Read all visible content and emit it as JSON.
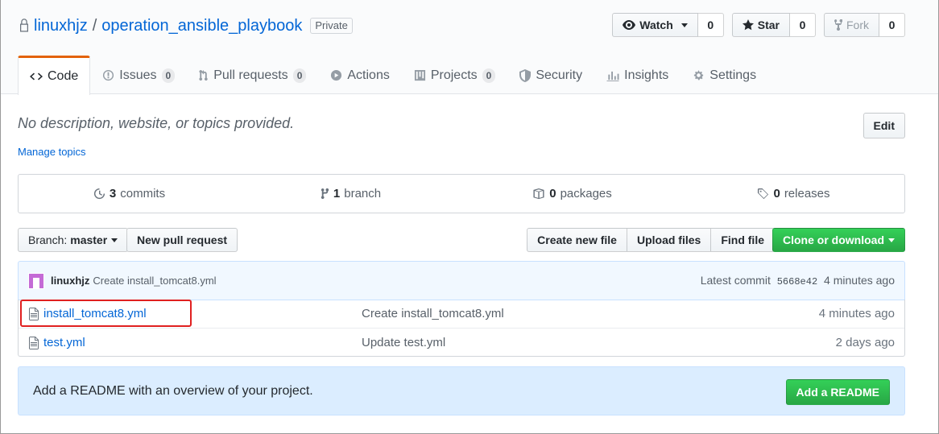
{
  "repo": {
    "owner": "linuxhjz",
    "separator": "/",
    "name": "operation_ansible_playbook",
    "visibility": "Private"
  },
  "actions": {
    "watch": {
      "label": "Watch",
      "count": "0"
    },
    "star": {
      "label": "Star",
      "count": "0"
    },
    "fork": {
      "label": "Fork",
      "count": "0"
    }
  },
  "tabs": [
    {
      "label": "Code",
      "icon": "code-icon",
      "selected": true
    },
    {
      "label": "Issues",
      "count": "0",
      "icon": "issue-icon"
    },
    {
      "label": "Pull requests",
      "count": "0",
      "icon": "pull-request-icon"
    },
    {
      "label": "Actions",
      "icon": "play-icon"
    },
    {
      "label": "Projects",
      "count": "0",
      "icon": "project-icon"
    },
    {
      "label": "Security",
      "icon": "shield-icon"
    },
    {
      "label": "Insights",
      "icon": "graph-icon"
    },
    {
      "label": "Settings",
      "icon": "gear-icon"
    }
  ],
  "about": {
    "description": "No description, website, or topics provided.",
    "manage_topics": "Manage topics",
    "edit": "Edit"
  },
  "summary": {
    "commits": {
      "count": "3",
      "label": "commits"
    },
    "branch": {
      "count": "1",
      "label": "branch"
    },
    "packages": {
      "count": "0",
      "label": "packages"
    },
    "releases": {
      "count": "0",
      "label": "releases"
    }
  },
  "file_nav": {
    "branch_label": "Branch:",
    "branch_value": "master",
    "new_pr": "New pull request",
    "create_file": "Create new file",
    "upload_files": "Upload files",
    "find_file": "Find file",
    "clone": "Clone or download"
  },
  "latest_commit": {
    "author": "linuxhjz",
    "message": "Create install_tomcat8.yml",
    "prefix": "Latest commit",
    "sha": "5668e42",
    "age": "4 minutes ago"
  },
  "files": [
    {
      "name": "install_tomcat8.yml",
      "message": "Create install_tomcat8.yml",
      "age": "4 minutes ago"
    },
    {
      "name": "test.yml",
      "message": "Update test.yml",
      "age": "2 days ago"
    }
  ],
  "readme": {
    "prompt": "Add a README with an overview of your project.",
    "button": "Add a README"
  },
  "colors": {
    "link": "#0366d6",
    "tab_accent": "#e36209",
    "primary_green": "#28a745",
    "annotation_red": "#e02020"
  }
}
